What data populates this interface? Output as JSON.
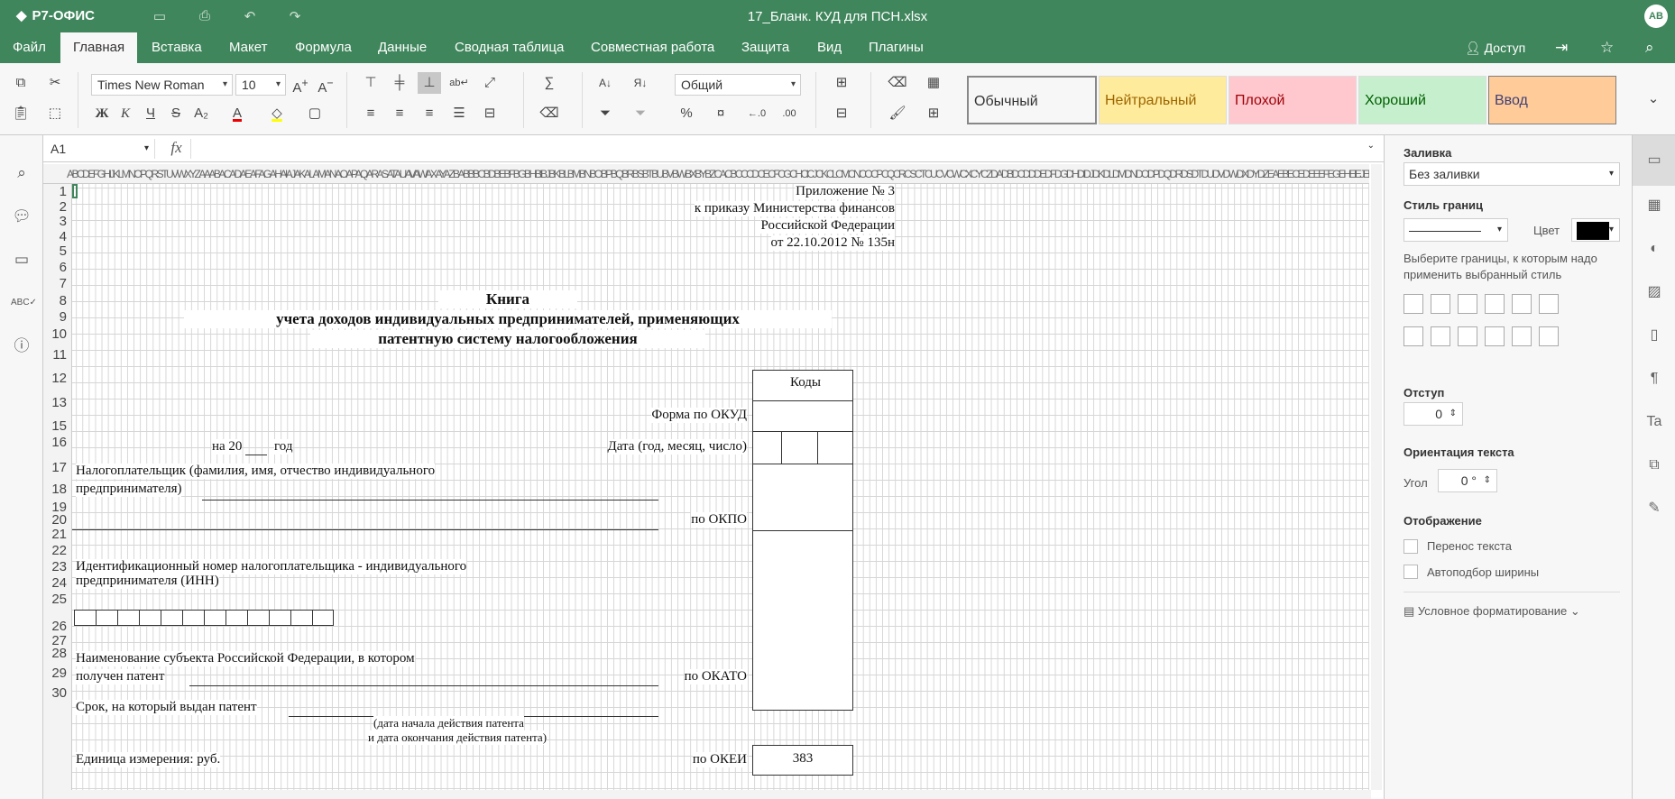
{
  "app": {
    "logo": "Р7-ОФИС",
    "file_title": "17_Бланк. КУД для ПСН.xlsx",
    "user_initials": "АВ"
  },
  "menu": {
    "tabs": [
      "Файл",
      "Главная",
      "Вставка",
      "Макет",
      "Формула",
      "Данные",
      "Сводная таблица",
      "Совместная работа",
      "Защита",
      "Вид",
      "Плагины"
    ],
    "active": "Главная",
    "access": "Доступ"
  },
  "toolbar": {
    "font_name": "Times New Roman",
    "font_size": "10",
    "number_format": "Общий",
    "cell_styles": [
      {
        "label": "Обычный",
        "bg": "#ffffff",
        "color": "#000000"
      },
      {
        "label": "Нейтральный",
        "bg": "#ffeb9c",
        "color": "#9c6500"
      },
      {
        "label": "Плохой",
        "bg": "#ffc7ce",
        "color": "#9c0006"
      },
      {
        "label": "Хороший",
        "bg": "#c6efce",
        "color": "#006100"
      },
      {
        "label": "Ввод",
        "bg": "#ffcc99",
        "color": "#3f3f76"
      }
    ],
    "bold": "Ж",
    "italic": "К",
    "underline": "Ч",
    "strike": "S"
  },
  "formula": {
    "cell_ref": "A1",
    "fx": "fx",
    "value": ""
  },
  "sheet": {
    "column_header_text": "ABCDEFGHIJKLMNOPQRSTUVWXYZAAABACADAEAFAGAHAIAJAKALAMANAOAPAQARASATAUAVAWAXAYAZBABBBCBDBEBFBGBHBIBJBKBLBMBNBOBPBQBRBSBTBUBVBWBXBYBZCACBCCCDCECFCGCHCICJCKCLCMCNCOCPCQCRCSCTCUCVCWCXCYCZDADBDCDDDEDFDGDHDIDJDKDLDMDNDODPDQDRDSDTDUDVDWDXDYDZEAEBECEDEEEFEGEHEIEJEKELEMENEOEPEQERESETEUEVEWEXEYEZFAFBFCFDFEFFFGFHFIFJFKFLFMFNFOFPFQFRFSFT",
    "rows": [
      "1",
      "2",
      "3",
      "4",
      "5",
      "6",
      "7",
      "8",
      "9",
      "10",
      "11",
      "12",
      "13",
      "15",
      "16",
      "17",
      "18",
      "19",
      "20",
      "21",
      "22",
      "23",
      "24",
      "25",
      "26",
      "27",
      "28",
      "29",
      "30"
    ],
    "appendix": [
      "Приложение № 3",
      "к приказу Министерства финансов",
      "Российской Федерации",
      "от 22.10.2012 № 135н"
    ],
    "title": [
      "Книга",
      "учета доходов индивидуальных предпринимателей, применяющих",
      "патентную систему налогообложения"
    ],
    "codes_header": "Коды",
    "okud": "Форма по ОКУД",
    "year_prefix": "на 20",
    "year_suffix": "год",
    "date_label": "Дата (год, месяц, число)",
    "taxpayer_1": "Налогоплательщик (фамилия, имя, отчество индивидуального",
    "taxpayer_2": "предпринимателя)",
    "okpo": "по ОКПО",
    "inn_1": "Идентификационный номер налогоплательщика - индивидуального",
    "inn_2": "предпринимателя (ИНН)",
    "region_1": "Наименование субъекта Российской Федерации, в котором",
    "region_2": "получен патент",
    "okato": "по ОКАТО",
    "term": "Срок, на который выдан патент",
    "term_note_1": "(дата начала действия патента",
    "term_note_2": "и дата окончания действия патента)",
    "unit": "Единица измерения: руб.",
    "okei": "по ОКЕИ",
    "okei_code": "383"
  },
  "right_panel": {
    "fill_label": "Заливка",
    "fill_value": "Без заливки",
    "border_style_label": "Стиль границ",
    "color_label": "Цвет",
    "border_color": "#000000",
    "border_hint": "Выберите границы, к которым надо применить выбранный стиль",
    "indent_label": "Отступ",
    "indent_value": "0",
    "orientation_label": "Ориентация текста",
    "angle_label": "Угол",
    "angle_value": "0 °",
    "display_label": "Отображение",
    "wrap_text": "Перенос текста",
    "autofit": "Автоподбор ширины",
    "conditional": "Условное форматирование"
  }
}
